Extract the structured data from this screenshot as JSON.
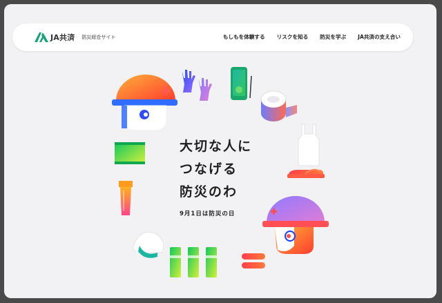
{
  "header": {
    "brand": "JA共済",
    "brand_sub": "防災総合サイト",
    "nav": [
      {
        "label": "もしもを体験する"
      },
      {
        "label": "リスクを知る"
      },
      {
        "label": "防災を学ぶ"
      },
      {
        "label": "JA共済の支え合い"
      }
    ]
  },
  "hero": {
    "lines": [
      "大切な人に",
      "つなげる",
      "防災のわ"
    ],
    "subtitle": "9月1日は防災の日"
  },
  "colors": {
    "page_background": "#f2f2f4",
    "logo_green": "#1aa37a",
    "text": "#1f1f1f"
  },
  "illustrations": [
    "helmet-person-orange-icon",
    "gloves-icon",
    "smartphone-icon",
    "tape-roll-icon",
    "plastic-bag-icon",
    "emergency-ration-icon",
    "flashlight-icon",
    "slippers-icon",
    "helmet-person-purple-icon",
    "rice-ball-icon",
    "water-bottles-icon",
    "bandage-icon"
  ]
}
